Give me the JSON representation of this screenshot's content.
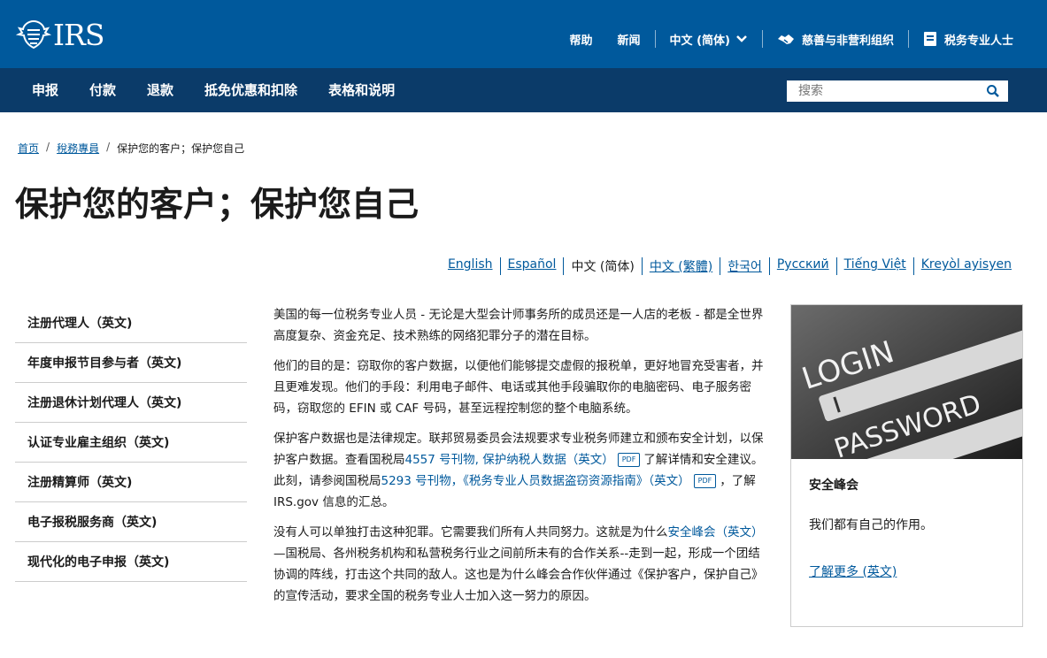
{
  "header": {
    "logo_text": "IRS",
    "links": [
      {
        "label": "帮助"
      },
      {
        "label": "新闻"
      },
      {
        "label": "中文 (简体)"
      },
      {
        "label": "慈善与非营利组织"
      },
      {
        "label": "税务专业人士"
      }
    ]
  },
  "nav": {
    "items": [
      "申报",
      "付款",
      "退款",
      "抵免优惠和扣除",
      "表格和说明"
    ],
    "search_placeholder": "搜索"
  },
  "breadcrumb": {
    "home": "首页",
    "section": "稅務專員",
    "current": "保护您的客户；保护您自己",
    "sep": "/"
  },
  "page_title": "保护您的客户；保护您自己",
  "languages": [
    {
      "label": "English"
    },
    {
      "label": "Español"
    },
    {
      "label": "中文 (简体)"
    },
    {
      "label": "中文 (繁體)"
    },
    {
      "label": "한국어"
    },
    {
      "label": "Русский"
    },
    {
      "label": "Tiếng Việt"
    },
    {
      "label": "Kreyòl ayisyen"
    }
  ],
  "sidebar": {
    "items": [
      "注册代理人（英文)",
      "年度申报节目参与者（英文)",
      "注册退休计划代理人（英文)",
      "认证专业雇主组织（英文)",
      "注册精算师（英文)",
      "电子报税服务商（英文)",
      "现代化的电子申报（英文)"
    ]
  },
  "content": {
    "p1": "美国的每一位税务专业人员 - 无论是大型会计师事务所的成员还是一人店的老板 - 都是全世界高度复杂、资金充足、技术熟练的网络犯罪分子的潜在目标。",
    "p2": "他们的目的是：窃取你的客户数据，以便他们能够提交虚假的报税单，更好地冒充受害者，并且更难发现。他们的手段：利用电子邮件、电话或其他手段骗取你的电脑密码、电子服务密码，窃取您的 EFIN 或 CAF 号码，甚至远程控制您的整个电脑系统。",
    "p3_a": "保护客户数据也是法律规定。联邦贸易委员会法规要求专业税务师建立和颁布安全计划，以保护客户数据。查看国税局",
    "p3_link1": "4557 号刊物, 保护纳税人数据（英文）",
    "p3_b": "了解详情和安全建议。此刻，请参阅国税局",
    "p3_link2": "5293 号刊物，《税务专业人员数据盗窃资源指南》（英文）",
    "p3_c": "，了解 IRS.gov 信息的汇总。",
    "pdf_label": "PDF",
    "p4_a": "没有人可以单独打击这种犯罪。它需要我们所有人共同努力。这就是为什么",
    "p4_link": "安全峰会（英文）",
    "p4_b": "—国税局、各州税务机构和私营税务行业之间前所未有的合作关系--走到一起，形成一个团结协调的阵线，打击这个共同的敌人。这也是为什么峰会合作伙伴通过《保护客户，保护自己》的宣传活动，要求全国的税务专业人士加入这一努力的原因。"
  },
  "card": {
    "img_text_1": "LOGIN",
    "img_text_2": "PASSWORD",
    "title": "安全峰会",
    "desc": "我们都有自己的作用。",
    "link": "了解更多 (英文)"
  },
  "colors": {
    "topbar": "#00599c",
    "navbar": "#0b3b69",
    "link": "#00599c"
  }
}
